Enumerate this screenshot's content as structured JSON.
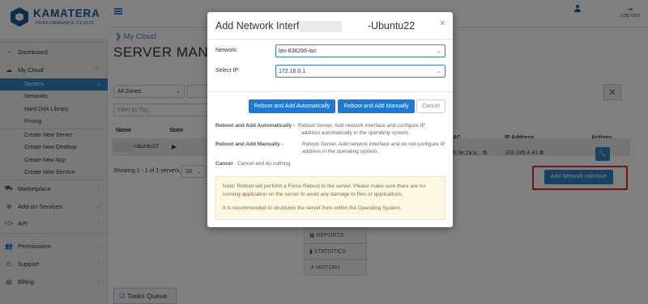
{
  "brand": {
    "name": "KAMATERA",
    "subtitle": "PERFORMANCE CLOUD"
  },
  "topbar": {
    "logout_label": "LOG OUT"
  },
  "sidebar": {
    "dashboard": "Dashboard",
    "my_cloud": "My Cloud",
    "servers": "Servers",
    "networks": "Networks",
    "hard_disk": "Hard Disk Library",
    "pricing": "Pricing",
    "create_server": "Create New Server",
    "create_desktop": "Create New Desktop",
    "create_app": "Create New App",
    "create_service": "Create New Service",
    "marketplace": "Marketplace",
    "addon": "Add-on Services",
    "api": "API",
    "permissions": "Permissions",
    "support": "Support",
    "billing": "Billing"
  },
  "main": {
    "breadcrumb": "My Cloud",
    "title": "SERVER MANAG",
    "zones_select": "All Zones",
    "filter_placeholder": "Filter by Tag",
    "col_name": "Name",
    "col_state": "State",
    "col_mac": "AC",
    "col_ip": "IP Address",
    "col_actions": "Actions",
    "row_name": "-Ubuntu22",
    "row_mac": "6:3e:2a:a...",
    "row_ip": "103.195.4.41",
    "showing": "Showing 1 - 1 of 1 servers,",
    "per_page": "10",
    "add_network_button": "Add Network Interface",
    "tab_reports": "REPORTS",
    "tab_statistics": "STATISTICS",
    "tab_history": "HISTORY",
    "tasks_queue": "Tasks Queue"
  },
  "modal": {
    "title_prefix": "Add Network Interface - ",
    "title_suffix": "-Ubuntu22",
    "network_label": "Network:",
    "network_value": "lan-836266-lan",
    "ip_label": "Select IP:",
    "ip_value": "172.16.0.1",
    "btn_auto": "Reboot and Add Automatically",
    "btn_manual": "Reboot and Add Manually",
    "btn_cancel": "Cancel",
    "desc_auto_title": "Reboot and Add Automatically -",
    "desc_auto_l1": "Reboot Server, Add network interface and configure IP",
    "desc_auto_l2": "address automatically in the operating system.",
    "desc_manual_title": "Reboot and Add Manually -",
    "desc_manual_l1": "Reboot Server, Add network interface and do not configure IP",
    "desc_manual_l2": "address in the operating system.",
    "desc_cancel_title": "Cancel",
    "desc_cancel_text": " - Cancel and do nothing.",
    "note_line1": "Note: Reboot will perform a Force Reboot to the server. Please make sure there are no",
    "note_line2": "running application on the server to avoid any damage to files or applications.",
    "note_line3": "It is recommended to shutdown the server from within the Operating System."
  },
  "colors": {
    "accent": "#2e85c9",
    "brand": "#1f5a95",
    "highlight": "#e8282b",
    "note_bg": "#fcf8e3"
  }
}
